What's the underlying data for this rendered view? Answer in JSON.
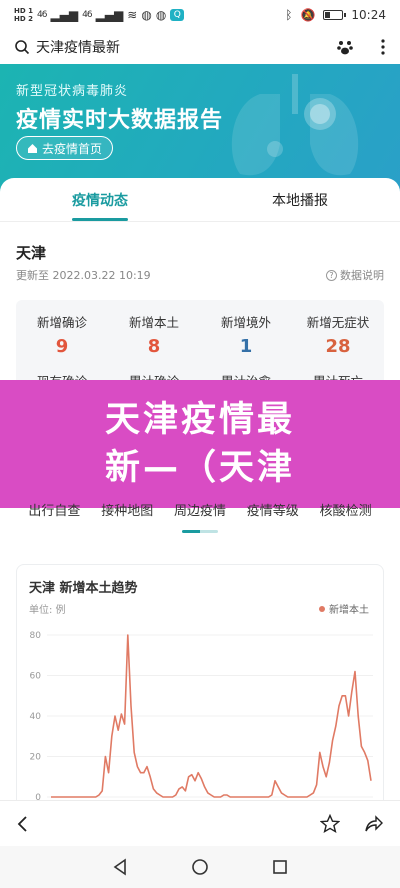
{
  "status_bar": {
    "sim1": "HD 1",
    "sim2": "HD 2",
    "signal1": "46",
    "signal2": "46",
    "time": "10:24",
    "battery_level": 0.3
  },
  "search": {
    "query": "天津疫情最新"
  },
  "banner": {
    "subtitle": "新型冠状病毒肺炎",
    "title": "疫情实时大数据报告",
    "home_button": "去疫情首页"
  },
  "tabs": [
    {
      "label": "疫情动态",
      "active": true
    },
    {
      "label": "本地播报",
      "active": false
    }
  ],
  "region": {
    "name": "天津",
    "updated": "更新至 2022.03.22 10:19",
    "explain": "数据说明"
  },
  "stats": [
    {
      "label": "新增确诊",
      "value": "9",
      "color": "#e2563d",
      "label2": "现有确诊"
    },
    {
      "label": "新增本土",
      "value": "8",
      "color": "#e2563d",
      "label2": "累计确诊"
    },
    {
      "label": "新增境外",
      "value": "1",
      "color": "#3571a8",
      "label2": "累计治愈"
    },
    {
      "label": "新增无症状",
      "value": "28",
      "color": "#d8623f",
      "label2": "累计死亡"
    }
  ],
  "overlay_title": {
    "line1": "天津疫情最",
    "line2": "新—（天津"
  },
  "subtabs": [
    "出行自查",
    "接种地图",
    "周边疫情",
    "疫情等级",
    "核酸检测"
  ],
  "chart_data": {
    "type": "line",
    "title": "天津 新增本土趋势",
    "ylabel": "单位: 例",
    "ylim": [
      0,
      80
    ],
    "yticks": [
      0,
      20,
      40,
      60,
      80
    ],
    "grid": true,
    "legend_position": "top-right",
    "series": [
      {
        "name": "新增本土",
        "color": "#e07a64",
        "values": [
          0,
          0,
          0,
          0,
          0,
          0,
          0,
          0,
          0,
          0,
          0,
          0,
          0,
          0,
          0,
          1,
          3,
          20,
          12,
          30,
          40,
          33,
          41,
          36,
          80,
          45,
          22,
          15,
          12,
          12,
          15,
          10,
          4,
          2,
          1,
          0,
          0,
          0,
          0,
          1,
          4,
          5,
          3,
          10,
          11,
          8,
          12,
          9,
          5,
          2,
          1,
          0,
          0,
          0,
          1,
          1,
          0,
          0,
          0,
          0,
          0,
          0,
          0,
          0,
          0,
          0,
          0,
          0,
          0,
          1,
          8,
          5,
          2,
          1,
          0,
          0,
          0,
          0,
          0,
          0,
          0,
          1,
          2,
          6,
          22,
          15,
          10,
          17,
          28,
          35,
          45,
          50,
          50,
          40,
          52,
          62,
          40,
          25,
          22,
          18,
          8
        ]
      }
    ]
  },
  "browser_bar": {
    "back": "back",
    "bookmark": "bookmark",
    "share": "share"
  },
  "nav_bar": [
    "back",
    "home",
    "recents"
  ]
}
